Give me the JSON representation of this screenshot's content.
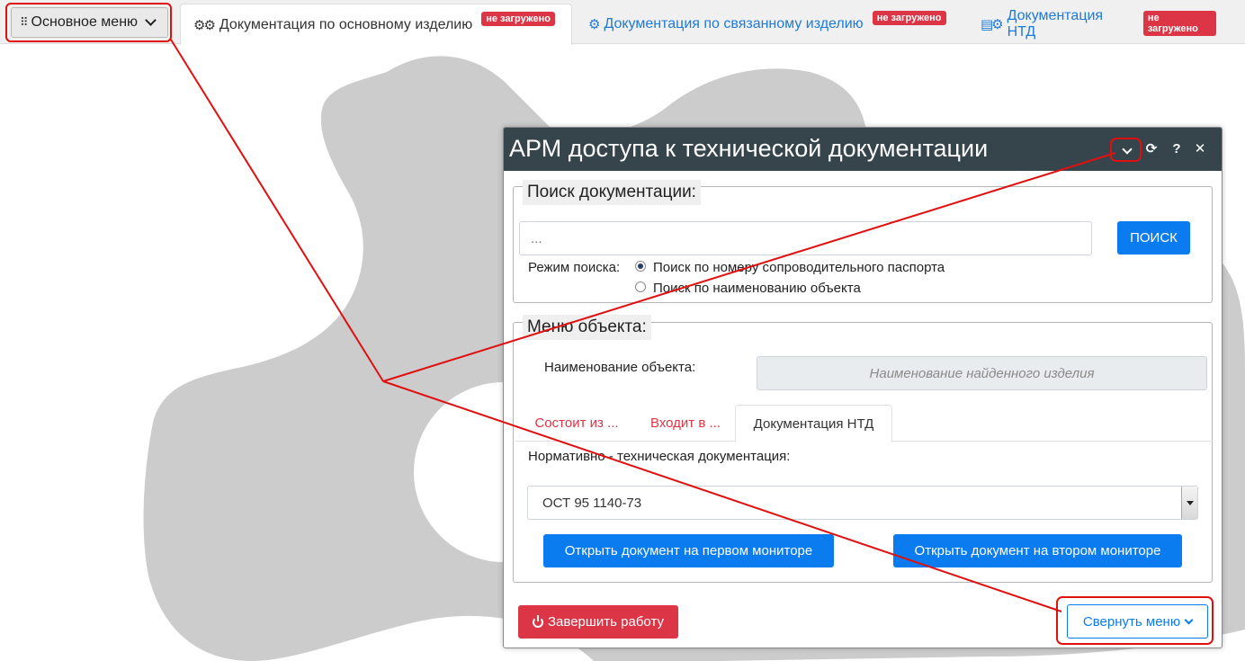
{
  "topbar": {
    "main_menu_label": "Основное меню",
    "tabs": [
      {
        "label": "Документация по основному изделию",
        "badge": "не загружено",
        "active": true
      },
      {
        "label": "Документация по связанному изделию",
        "badge": "не загружено",
        "active": false
      },
      {
        "label": "Документация НТД",
        "badge": "не загружено",
        "active": false
      }
    ]
  },
  "dialog": {
    "title": "АРМ доступа к технической документации",
    "header_buttons": {
      "collapse": "collapse",
      "refresh": "⟳",
      "help": "?",
      "close": "✕"
    },
    "search": {
      "legend": "Поиск документации:",
      "input_placeholder": "...",
      "button": "ПОИСК",
      "mode_label": "Режим поиска:",
      "modes": [
        {
          "label": "Поиск по номеру сопроводительного паспорта",
          "checked": true
        },
        {
          "label": "Поиск по наименованию объекта",
          "checked": false
        }
      ]
    },
    "object_menu": {
      "legend": "Меню объекта:",
      "name_label": "Наименование объекта:",
      "name_placeholder": "Наименование найденного изделия",
      "tabs": [
        "Состоит из ...",
        "Входит в ...",
        "Документация НТД"
      ],
      "active_tab": 2,
      "ntd_label": "Нормативно - техническая документация:",
      "selected_document": "ОСТ 95 1140-73",
      "open_first": "Открыть документ на первом мониторе",
      "open_second": "Открыть документ на втором мониторе"
    },
    "footer": {
      "exit_button": "Завершить работу",
      "collapse_menu_button": "Свернуть меню"
    }
  },
  "colors": {
    "header_bg": "#36444c",
    "primary": "#0a7cf0",
    "danger": "#dc3545",
    "annotation": "#e01010",
    "background_gear": "#cccccc"
  }
}
